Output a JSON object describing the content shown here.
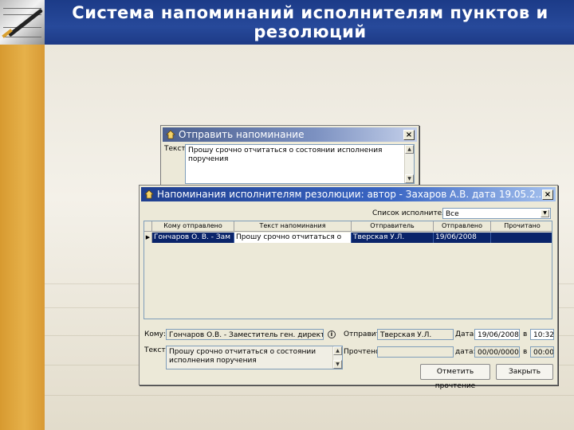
{
  "slide": {
    "title": "Система напоминаний исполнителям пунктов и резолюций"
  },
  "back_window": {
    "title": "Отправить напоминание",
    "text_label": "Текст:",
    "text_value": "Прошу срочно отчитаться о состоянии исполнения поручения"
  },
  "front_window": {
    "title": "Напоминания исполнителям резолюции: автор - Захаров А.В. дата 19.05.2...",
    "executors_label": "Список исполнителей:",
    "executors_value": "Все",
    "columns": [
      "Кому отправлено",
      "Текст напоминания",
      "Отправитель",
      "Отправлено",
      "Прочитано"
    ],
    "rows": [
      {
        "recipient": "Гончаров О. В. - Зам",
        "text": "Прошу срочно отчитаться о",
        "sender": "Тверская У.Л.",
        "sent": "19/06/2008",
        "read": ""
      }
    ],
    "to_label": "Кому:",
    "to_value": "Гончаров О.В. - Заместитель ген. директора",
    "sender_label": "Отправит.",
    "sender_value": "Тверская У.Л.",
    "date_label": "Дата:",
    "date_value": "19/06/2008",
    "time_sep": "в",
    "time_value": "10:32",
    "text_label": "Текст:",
    "text_value": "Прошу срочно отчитаться о состоянии исполнения поручения",
    "read_label": "Прочтено",
    "read_value": "",
    "date2_label": "дата:",
    "date2_value": "00/00/0000",
    "time2_sep": "в",
    "time2_value": "00:00",
    "mark_read_label": "Отметить прочтение",
    "close_label": "Закрыть"
  }
}
